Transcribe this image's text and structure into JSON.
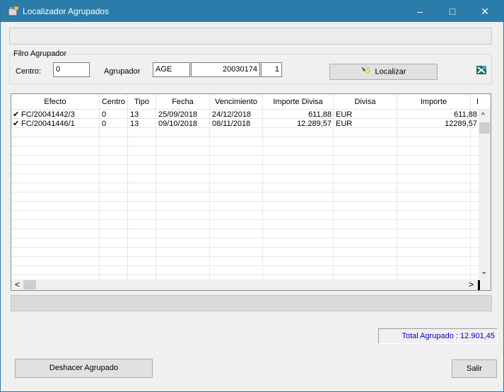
{
  "window": {
    "title": "Localizador Agrupados",
    "minimize_label": "–",
    "maximize_label": "□",
    "close_label": "✕"
  },
  "filter": {
    "group_label": "Filro Agrupador",
    "centro_label": "Centro:",
    "centro_value": "0",
    "agrupador_label": "Agrupador",
    "agrupador_code": "AGE",
    "agrupador_number": "20030174",
    "agrupador_seq": "1",
    "localizar_label": "Localizar"
  },
  "grid": {
    "columns": [
      "Efecto",
      "Centro",
      "Tipo",
      "Fecha",
      "Vencimiento",
      "Importe Divisa",
      "Divisa",
      "Importe",
      "I"
    ],
    "rows": [
      {
        "check": "✔",
        "efecto": "FC/20041442/3",
        "centro": "0",
        "tipo": "13",
        "fecha": "25/09/2018",
        "vencimiento": "24/12/2018",
        "importe_divisa": "611,88",
        "divisa": "EUR",
        "importe": "611,88"
      },
      {
        "check": "✔",
        "efecto": "FC/20041446/1",
        "centro": "0",
        "tipo": "13",
        "fecha": "09/10/2018",
        "vencimiento": "08/11/2018",
        "importe_divisa": "12.289,57",
        "divisa": "EUR",
        "importe": "12289,57"
      }
    ]
  },
  "total": "Total Agrupado : 12.901,45",
  "buttons": {
    "deshacer": "Deshacer Agrupado",
    "salir": "Salir"
  },
  "colors": {
    "titlebar": "#2b7cab",
    "total_text": "#0000cc"
  },
  "icons": {
    "app": "app-window-icon",
    "localizar": "flashlight-icon",
    "excel": "excel-export-icon"
  }
}
